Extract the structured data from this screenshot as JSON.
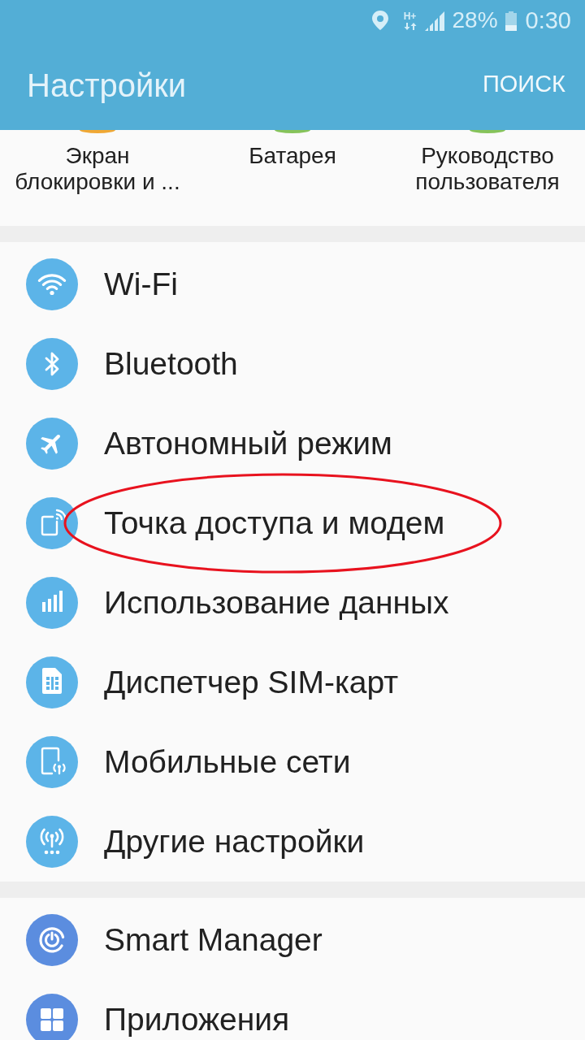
{
  "status_bar": {
    "network_type": "H+",
    "battery": "28%",
    "time": "0:30"
  },
  "toolbar": {
    "title": "Настройки",
    "action": "ПОИСК"
  },
  "quick_settings": [
    {
      "label": "Экран\nблокировки и ...",
      "color": "#f0a834"
    },
    {
      "label": "Батарея",
      "color": "#86c35a"
    },
    {
      "label": "Руководство\nпользователя",
      "color": "#86c35a"
    }
  ],
  "sections": [
    {
      "items": [
        {
          "label": "Wi-Fi",
          "highlighted": false
        },
        {
          "label": "Bluetooth",
          "highlighted": false
        },
        {
          "label": "Автономный режим",
          "highlighted": false
        },
        {
          "label": "Точка доступа и модем",
          "highlighted": true
        },
        {
          "label": "Использование данных",
          "highlighted": false
        },
        {
          "label": "Диспетчер SIM-карт",
          "highlighted": false
        },
        {
          "label": "Мобильные сети",
          "highlighted": false
        },
        {
          "label": "Другие настройки",
          "highlighted": false
        }
      ]
    },
    {
      "items": [
        {
          "label": "Smart Manager",
          "highlighted": false
        },
        {
          "label": "Приложения",
          "highlighted": false
        }
      ]
    }
  ]
}
